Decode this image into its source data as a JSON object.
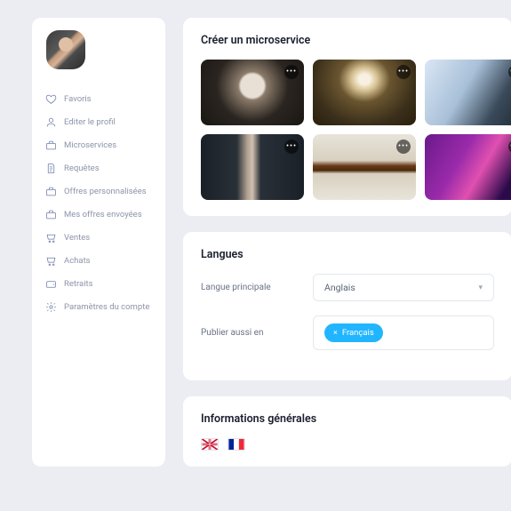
{
  "sidebar": {
    "items": [
      {
        "icon": "heart-icon",
        "label": "Favoris"
      },
      {
        "icon": "user-icon",
        "label": "Editer le profil"
      },
      {
        "icon": "briefcase-icon",
        "label": "Microservices"
      },
      {
        "icon": "note-icon",
        "label": "Requêtes"
      },
      {
        "icon": "briefcase-icon",
        "label": "Offres personnalisées"
      },
      {
        "icon": "briefcase-icon",
        "label": "Mes offres envoyées"
      },
      {
        "icon": "cart-icon",
        "label": "Ventes"
      },
      {
        "icon": "cart-icon",
        "label": "Achats"
      },
      {
        "icon": "wallet-icon",
        "label": "Retraits"
      },
      {
        "icon": "gear-icon",
        "label": "Paramètres du compte"
      }
    ]
  },
  "sections": {
    "microservice": {
      "title": "Créer un microservice",
      "tiles": [
        {
          "name": "studio-monitor"
        },
        {
          "name": "concert-lights"
        },
        {
          "name": "tablet-hands"
        },
        {
          "name": "singer-mic"
        },
        {
          "name": "violin-sheet"
        },
        {
          "name": "stage-purple"
        }
      ]
    },
    "languages": {
      "title": "Langues",
      "primary_label": "Langue principale",
      "primary_value": "Anglais",
      "also_label": "Publier aussi en",
      "chip": "Français"
    },
    "general": {
      "title": "Informations générales",
      "flags": [
        "uk",
        "fr"
      ]
    }
  }
}
